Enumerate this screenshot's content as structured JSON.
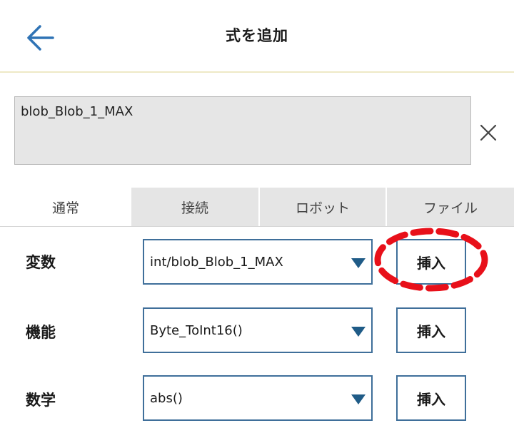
{
  "header": {
    "title": "式を追加",
    "back_icon": "arrow-left-icon"
  },
  "expression": {
    "value": "blob_Blob_1_MAX",
    "clear_icon": "close-icon"
  },
  "tabs": [
    {
      "label": "通常",
      "active": true
    },
    {
      "label": "接続",
      "active": false
    },
    {
      "label": "ロボット",
      "active": false
    },
    {
      "label": "ファイル",
      "active": false
    }
  ],
  "rows": [
    {
      "label": "変数",
      "selected": "int/blob_Blob_1_MAX",
      "button": "挿入"
    },
    {
      "label": "機能",
      "selected": "Byte_ToInt16()",
      "button": "挿入"
    },
    {
      "label": "数学",
      "selected": "abs()",
      "button": "挿入"
    }
  ],
  "colors": {
    "accent": "#1f5b87",
    "highlight": "#e8101a",
    "header_divider": "#eee9c6"
  }
}
